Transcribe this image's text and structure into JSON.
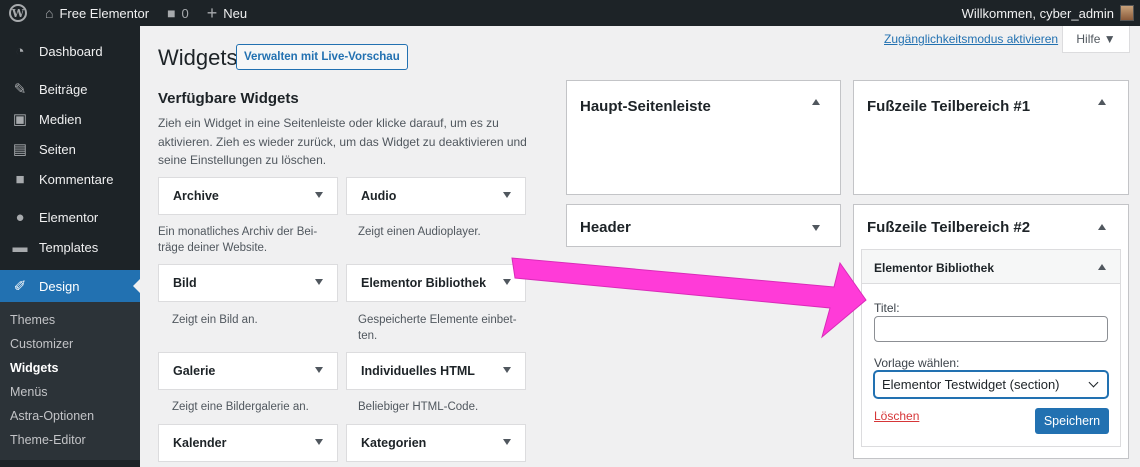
{
  "adminbar": {
    "site_name": "Free Elementor",
    "comments_count": "0",
    "new_label": "Neu",
    "greeting": "Willkommen, cyber_admin"
  },
  "sidebar": {
    "items": [
      {
        "label": "Dashboard",
        "icon": "dashboard-icon"
      },
      {
        "label": "Beiträge",
        "icon": "pin-icon"
      },
      {
        "label": "Medien",
        "icon": "media-icon"
      },
      {
        "label": "Seiten",
        "icon": "page-icon"
      },
      {
        "label": "Kommentare",
        "icon": "comment-icon"
      },
      {
        "label": "Elementor",
        "icon": "elementor-icon"
      },
      {
        "label": "Templates",
        "icon": "folder-icon"
      },
      {
        "label": "Design",
        "icon": "brush-icon"
      }
    ],
    "submenu": [
      "Themes",
      "Customizer",
      "Widgets",
      "Menüs",
      "Astra-Optionen",
      "Theme-Editor"
    ]
  },
  "screen_meta": {
    "a11y_link": "Zugänglichkeitsmodus aktivieren",
    "help": "Hilfe ▼"
  },
  "header": {
    "title": "Widgets",
    "live_preview_button": "Verwalten mit Live-Vorschau"
  },
  "available": {
    "title": "Verfügbare Widgets",
    "description": "Zieh ein Widget in eine Seitenleiste oder klicke darauf, um es zu aktivieren. Zieh es wieder zurück, um das Widget zu deaktivieren und seine Einstellungen zu löschen.",
    "widgets": [
      {
        "name": "Archive",
        "desc": "Ein monatliches Archiv der Bei-träge deiner Website."
      },
      {
        "name": "Audio",
        "desc": "Zeigt einen Audioplayer."
      },
      {
        "name": "Bild",
        "desc": "Zeigt ein Bild an."
      },
      {
        "name": "Elementor Bibliothek",
        "desc": "Gespeicherte Elemente einbet-ten."
      },
      {
        "name": "Galerie",
        "desc": "Zeigt eine Bildergalerie an."
      },
      {
        "name": "Individuelles HTML",
        "desc": "Beliebiger HTML-Code."
      },
      {
        "name": "Kalender",
        "desc": ""
      },
      {
        "name": "Kategorien",
        "desc": ""
      }
    ]
  },
  "widget_areas": [
    {
      "title": "Haupt-Seitenleiste"
    },
    {
      "title": "Fußzeile Teilbereich #1"
    },
    {
      "title": "Header"
    },
    {
      "title": "Fußzeile Teilbereich #2"
    }
  ],
  "open_widget": {
    "title": "Elementor Bibliothek",
    "title_label": "Titel:",
    "title_value": "",
    "template_label": "Vorlage wählen:",
    "template_selected": "Elementor Testwidget (section)",
    "delete_link": "Löschen",
    "save_button": "Speichern"
  },
  "colors": {
    "accent": "#2271b1",
    "adminbar": "#1d2327",
    "annotation_arrow": "#ff3bd8",
    "delete": "#d63638"
  }
}
